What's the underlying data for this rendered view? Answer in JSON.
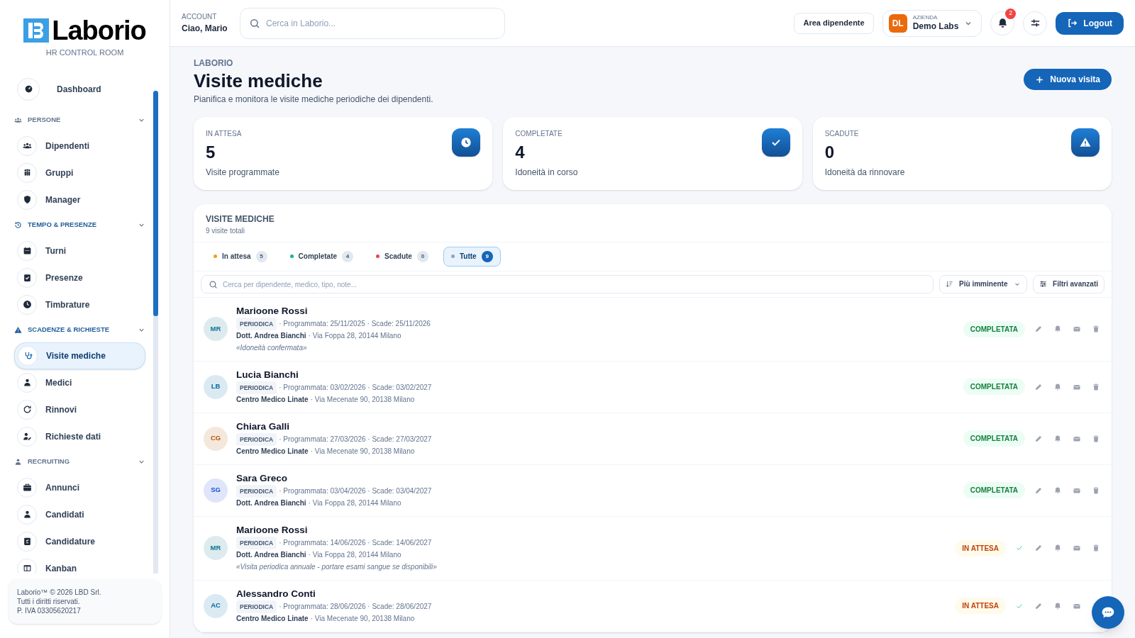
{
  "brand": {
    "name": "Laborio",
    "subtitle": "HR CONTROL ROOM"
  },
  "sidebar": {
    "top": {
      "label": "Dashboard",
      "selected": false
    },
    "sections": [
      {
        "label": "PERSONE",
        "expanded": true,
        "items": [
          {
            "label": "Dipendenti",
            "selected": false
          },
          {
            "label": "Gruppi",
            "selected": false
          },
          {
            "label": "Manager",
            "selected": false
          }
        ]
      },
      {
        "label": "TEMPO & PRESENZE",
        "expanded": true,
        "items": [
          {
            "label": "Turni",
            "selected": false
          },
          {
            "label": "Presenze",
            "selected": false
          },
          {
            "label": "Timbrature",
            "selected": false
          }
        ]
      },
      {
        "label": "SCADENZE & RICHIESTE",
        "expanded": true,
        "items": [
          {
            "label": "Visite mediche",
            "selected": true
          },
          {
            "label": "Medici",
            "selected": false
          },
          {
            "label": "Rinnovi",
            "selected": false
          },
          {
            "label": "Richieste dati",
            "selected": false
          }
        ]
      },
      {
        "label": "RECRUITING",
        "expanded": true,
        "items": [
          {
            "label": "Annunci",
            "selected": false
          },
          {
            "label": "Candidati",
            "selected": false
          },
          {
            "label": "Candidature",
            "selected": false
          },
          {
            "label": "Kanban",
            "selected": false
          }
        ]
      }
    ],
    "footer": [
      "Laborio™ © 2026 LBD Srl.",
      "Tutti i diritti riservati.",
      "P. IVA 03305620217"
    ]
  },
  "header": {
    "account_label": "ACCOUNT",
    "account_name": "Ciao, Mario",
    "search": {
      "placeholder": "Cerca in Laborio..."
    },
    "employee_area": "Area dipendente",
    "company": {
      "initials": "DL",
      "label": "AZIENDA",
      "name": "Demo Labs"
    },
    "notifications": "2",
    "logout": "Logout"
  },
  "page": {
    "eyebrow": "LABORIO",
    "title": "Visite mediche",
    "subtitle": "Pianifica e monitora le visite mediche periodiche dei dipendenti.",
    "new_button": "Nuova visita"
  },
  "stats": [
    {
      "label": "IN ATTESA",
      "value": "5",
      "caption": "Visite programmate",
      "kind": "clock"
    },
    {
      "label": "COMPLETATE",
      "value": "4",
      "caption": "Idoneità in corso",
      "kind": "check"
    },
    {
      "label": "SCADUTE",
      "value": "0",
      "caption": "Idoneità da rinnovare",
      "kind": "warning"
    }
  ],
  "visits": {
    "title": "VISITE MEDICHE",
    "count": "9 visite totali",
    "filters": [
      {
        "label": "In attesa",
        "count": "5",
        "color": "#f59e0b",
        "selected": false
      },
      {
        "label": "Completate",
        "count": "4",
        "color": "#10b981",
        "selected": false
      },
      {
        "label": "Scadute",
        "count": "0",
        "color": "#ef4444",
        "selected": false
      },
      {
        "label": "Tutte",
        "count": "9",
        "color": "#94a3b8",
        "selected": true
      }
    ],
    "search": {
      "placeholder": "Cerca per dipendente, medico, tipo, note..."
    },
    "sort": "Più imminente",
    "advanced": "Filtri avanzati",
    "rows": [
      {
        "initials": "MR",
        "color": "#0e7490",
        "name": "Marioone Rossi",
        "type": "PERIODICA",
        "dates": "· Programmata: 25/11/2025 · Scade: 25/11/2026",
        "place": "Dott. Andrea Bianchi",
        "address": "· Via Foppa 28, 20144 Milano",
        "note": "«Idoneità confermata»",
        "status": {
          "label": "COMPLETATA",
          "kind": "completed"
        }
      },
      {
        "initials": "LB",
        "color": "#0369a1",
        "name": "Lucia Bianchi",
        "type": "PERIODICA",
        "dates": "· Programmata: 03/02/2026 · Scade: 03/02/2027",
        "place": "Centro Medico Linate",
        "address": "· Via Mecenate 90, 20138 Milano",
        "status": {
          "label": "COMPLETATA",
          "kind": "completed"
        }
      },
      {
        "initials": "CG",
        "color": "#b45309",
        "name": "Chiara Galli",
        "type": "PERIODICA",
        "dates": "· Programmata: 27/03/2026 · Scade: 27/03/2027",
        "place": "Centro Medico Linate",
        "address": "· Via Mecenate 90, 20138 Milano",
        "status": {
          "label": "COMPLETATA",
          "kind": "completed"
        }
      },
      {
        "initials": "SG",
        "color": "#1d4ed8",
        "name": "Sara Greco",
        "type": "PERIODICA",
        "dates": "· Programmata: 03/04/2026 · Scade: 03/04/2027",
        "place": "Dott. Andrea Bianchi",
        "address": "· Via Foppa 28, 20144 Milano",
        "status": {
          "label": "COMPLETATA",
          "kind": "completed"
        }
      },
      {
        "initials": "MR",
        "color": "#0e7490",
        "name": "Marioone Rossi",
        "type": "PERIODICA",
        "dates": "· Programmata: 14/06/2026 · Scade: 14/06/2027",
        "place": "Dott. Andrea Bianchi",
        "address": "· Via Foppa 28, 20144 Milano",
        "note": "«Visita periodica annuale - portare esami sangue se disponibili»",
        "status": {
          "label": "IN ATTESA",
          "kind": "pending"
        }
      },
      {
        "initials": "AC",
        "color": "#0369a1",
        "name": "Alessandro Conti",
        "type": "PERIODICA",
        "dates": "· Programmata: 28/06/2026 · Scade: 28/06/2027",
        "place": "Centro Medico Linate",
        "address": "· Via Mecenate 90, 20138 Milano",
        "status": {
          "label": "IN ATTESA",
          "kind": "pending"
        }
      }
    ]
  }
}
